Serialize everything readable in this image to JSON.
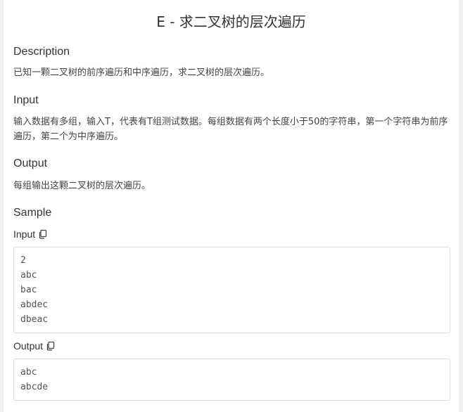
{
  "problem": {
    "title": "E - 求二叉树的层次遍历"
  },
  "description": {
    "heading": "Description",
    "text": "已知一颗二叉树的前序遍历和中序遍历，求二叉树的层次遍历。"
  },
  "input": {
    "heading": "Input",
    "text": "输入数据有多组，输入T，代表有T组测试数据。每组数据有两个长度小于50的字符串，第一个字符串为前序遍历，第二个为中序遍历。"
  },
  "output": {
    "heading": "Output",
    "text": "每组输出这颗二叉树的层次遍历。"
  },
  "sample": {
    "heading": "Sample",
    "input_label": "Input",
    "input_lines": [
      "2",
      "abc",
      "bac",
      "abdec",
      "dbeac"
    ],
    "output_label": "Output",
    "output_lines": [
      "abc",
      "abcde"
    ],
    "copy_icon": "copy-icon"
  }
}
